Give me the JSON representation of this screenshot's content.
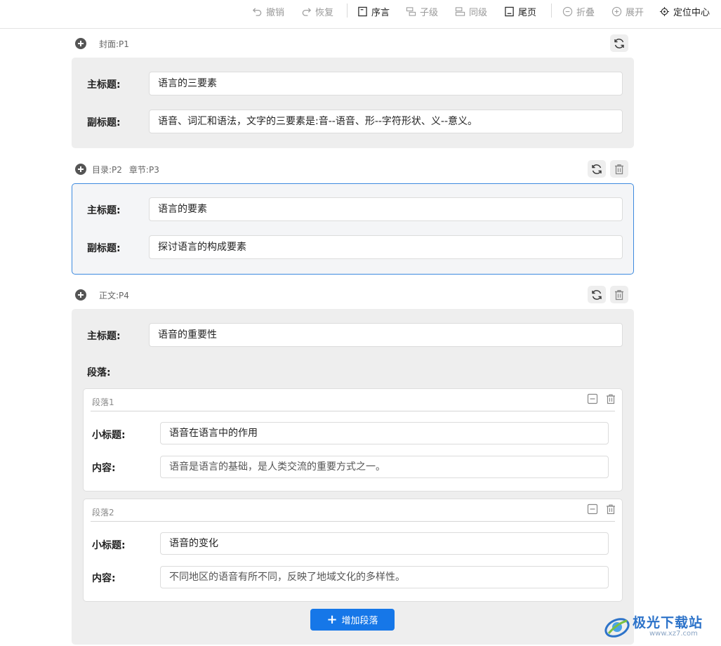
{
  "toolbar": {
    "undo": "撤销",
    "redo": "恢复",
    "preface": "序言",
    "child": "子级",
    "sibling": "同级",
    "tail": "尾页",
    "collapse": "折叠",
    "expand": "展开",
    "center": "定位中心"
  },
  "cover": {
    "label": "封面:P1",
    "main_title_label": "主标题:",
    "main_title_value": "语言的三要素",
    "sub_title_label": "副标题:",
    "sub_title_value": "语音、词汇和语法，文字的三要素是:音--语音、形--字符形状、义--意义。"
  },
  "toc": {
    "label_a": "目录:P2",
    "label_b": "章节:P3",
    "main_title_label": "主标题:",
    "main_title_value": "语言的要素",
    "sub_title_label": "副标题:",
    "sub_title_value": "探讨语言的构成要素"
  },
  "body": {
    "label": "正文:P4",
    "main_title_label": "主标题:",
    "main_title_value": "语音的重要性",
    "paragraphs_label": "段落:",
    "paragraphs": [
      {
        "title": "段落1",
        "subtitle_label": "小标题:",
        "subtitle_value": "语音在语言中的作用",
        "content_label": "内容:",
        "content_value": "语音是语言的基础，是人类交流的重要方式之一。"
      },
      {
        "title": "段落2",
        "subtitle_label": "小标题:",
        "subtitle_value": "语音的变化",
        "content_label": "内容:",
        "content_value": "不同地区的语音有所不同，反映了地域文化的多样性。"
      }
    ],
    "add_button": "增加段落"
  },
  "watermark": {
    "brand": "极光下载站",
    "url": "www.xz7.com"
  },
  "colors": {
    "accent": "#1677e8",
    "selected_border": "#3d8adf",
    "card_bg": "#eeeeee"
  }
}
